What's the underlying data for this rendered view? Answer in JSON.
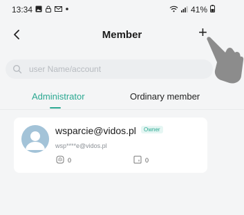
{
  "status_bar": {
    "time": "13:34",
    "battery": "41%",
    "icons": [
      "image-icon",
      "lock-icon",
      "mail-icon",
      "dot-icon",
      "wifi-icon",
      "signal-icon",
      "battery-icon"
    ]
  },
  "header": {
    "title": "Member",
    "back_icon": "chevron-left-icon",
    "add_label": "+"
  },
  "search": {
    "placeholder": "user Name/account",
    "value": ""
  },
  "tabs": [
    {
      "label": "Administrator",
      "active": true
    },
    {
      "label": "Ordinary member",
      "active": false
    }
  ],
  "members": [
    {
      "name": "wsparcie@vidos.pl",
      "role_badge": "Owner",
      "account": "wsp****e@vidos.pl",
      "fingerprint_count": "0",
      "card_count": "0"
    }
  ],
  "colors": {
    "accent": "#2aa891",
    "background": "#f4f5f6",
    "card": "#ffffff",
    "avatar": "#a3c3d8"
  }
}
